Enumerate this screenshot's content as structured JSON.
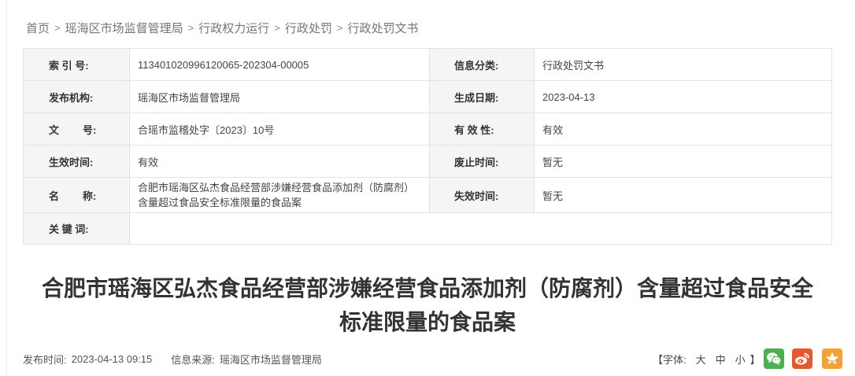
{
  "breadcrumb": {
    "items": [
      "首页",
      "瑶海区市场监督管理局",
      "行政权力运行",
      "行政处罚",
      "行政处罚文书"
    ],
    "separator": ">"
  },
  "info": {
    "index_label": "索 引 号:",
    "index_value": "113401020996120065-202304-00005",
    "category_label": "信息分类:",
    "category_value": "行政处罚文书",
    "publisher_label": "发布机构:",
    "publisher_value": "瑶海区市场监督管理局",
    "created_label": "生成日期:",
    "created_value": "2023-04-13",
    "docno_label_a": "文",
    "docno_label_b": "号:",
    "docno_value": "合瑶市监稽处字〔2023〕10号",
    "validity_label": "有 效 性:",
    "validity_value": "有效",
    "effective_label": "生效时间:",
    "effective_value": "有效",
    "repeal_label": "废止时间:",
    "repeal_value": "暂无",
    "name_label_a": "名",
    "name_label_b": "称:",
    "name_value": "合肥市瑶海区弘杰食品经营部涉嫌经营食品添加剂（防腐剂）含量超过食品安全标准限量的食品案",
    "expire_label": "失效时间:",
    "expire_value": "暂无",
    "keywords_label": "关 键 词:",
    "keywords_value": ""
  },
  "title": "合肥市瑶海区弘杰食品经营部涉嫌经营食品添加剂（防腐剂）含量超过食品安全标准限量的食品案",
  "meta": {
    "publish_time_label": "发布时间:",
    "publish_time_value": "2023-04-13 09:15",
    "source_label": "信息来源:",
    "source_value": "瑶海区市场监督管理局"
  },
  "font_control": {
    "open_bracket": "【字体:",
    "large": "大",
    "medium": "中",
    "small": "小",
    "close_bracket": "】"
  },
  "share": {
    "wechat_icon": "wechat-icon",
    "weibo_icon": "weibo-icon",
    "favorite_icon": "star-icon",
    "wechat_color": "#4caf50",
    "weibo_color": "#e5592c",
    "favorite_color": "#f4a236"
  }
}
